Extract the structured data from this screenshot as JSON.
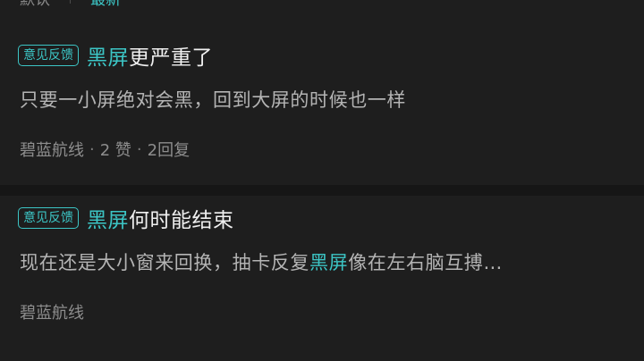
{
  "sort": {
    "default_label": "默认",
    "latest_label": "最新"
  },
  "posts": [
    {
      "tag": "意见反馈",
      "title_highlight": "黑屏",
      "title_rest": "更严重了",
      "snippet": "只要一小屏绝对会黑，回到大屏的时候也一样",
      "author": "碧蓝航线",
      "likes": "2 赞",
      "replies": "2回复"
    },
    {
      "tag": "意见反馈",
      "title_highlight": "黑屏",
      "title_rest": "何时能结束",
      "snippet_before": "现在还是大小窗来回换，抽卡反复",
      "snippet_highlight": "黑屏",
      "snippet_after": "像在左右脑互搏…",
      "author": "碧蓝航线"
    }
  ],
  "colors": {
    "accent": "#3cc5c5",
    "background": "#1e1e1e"
  }
}
